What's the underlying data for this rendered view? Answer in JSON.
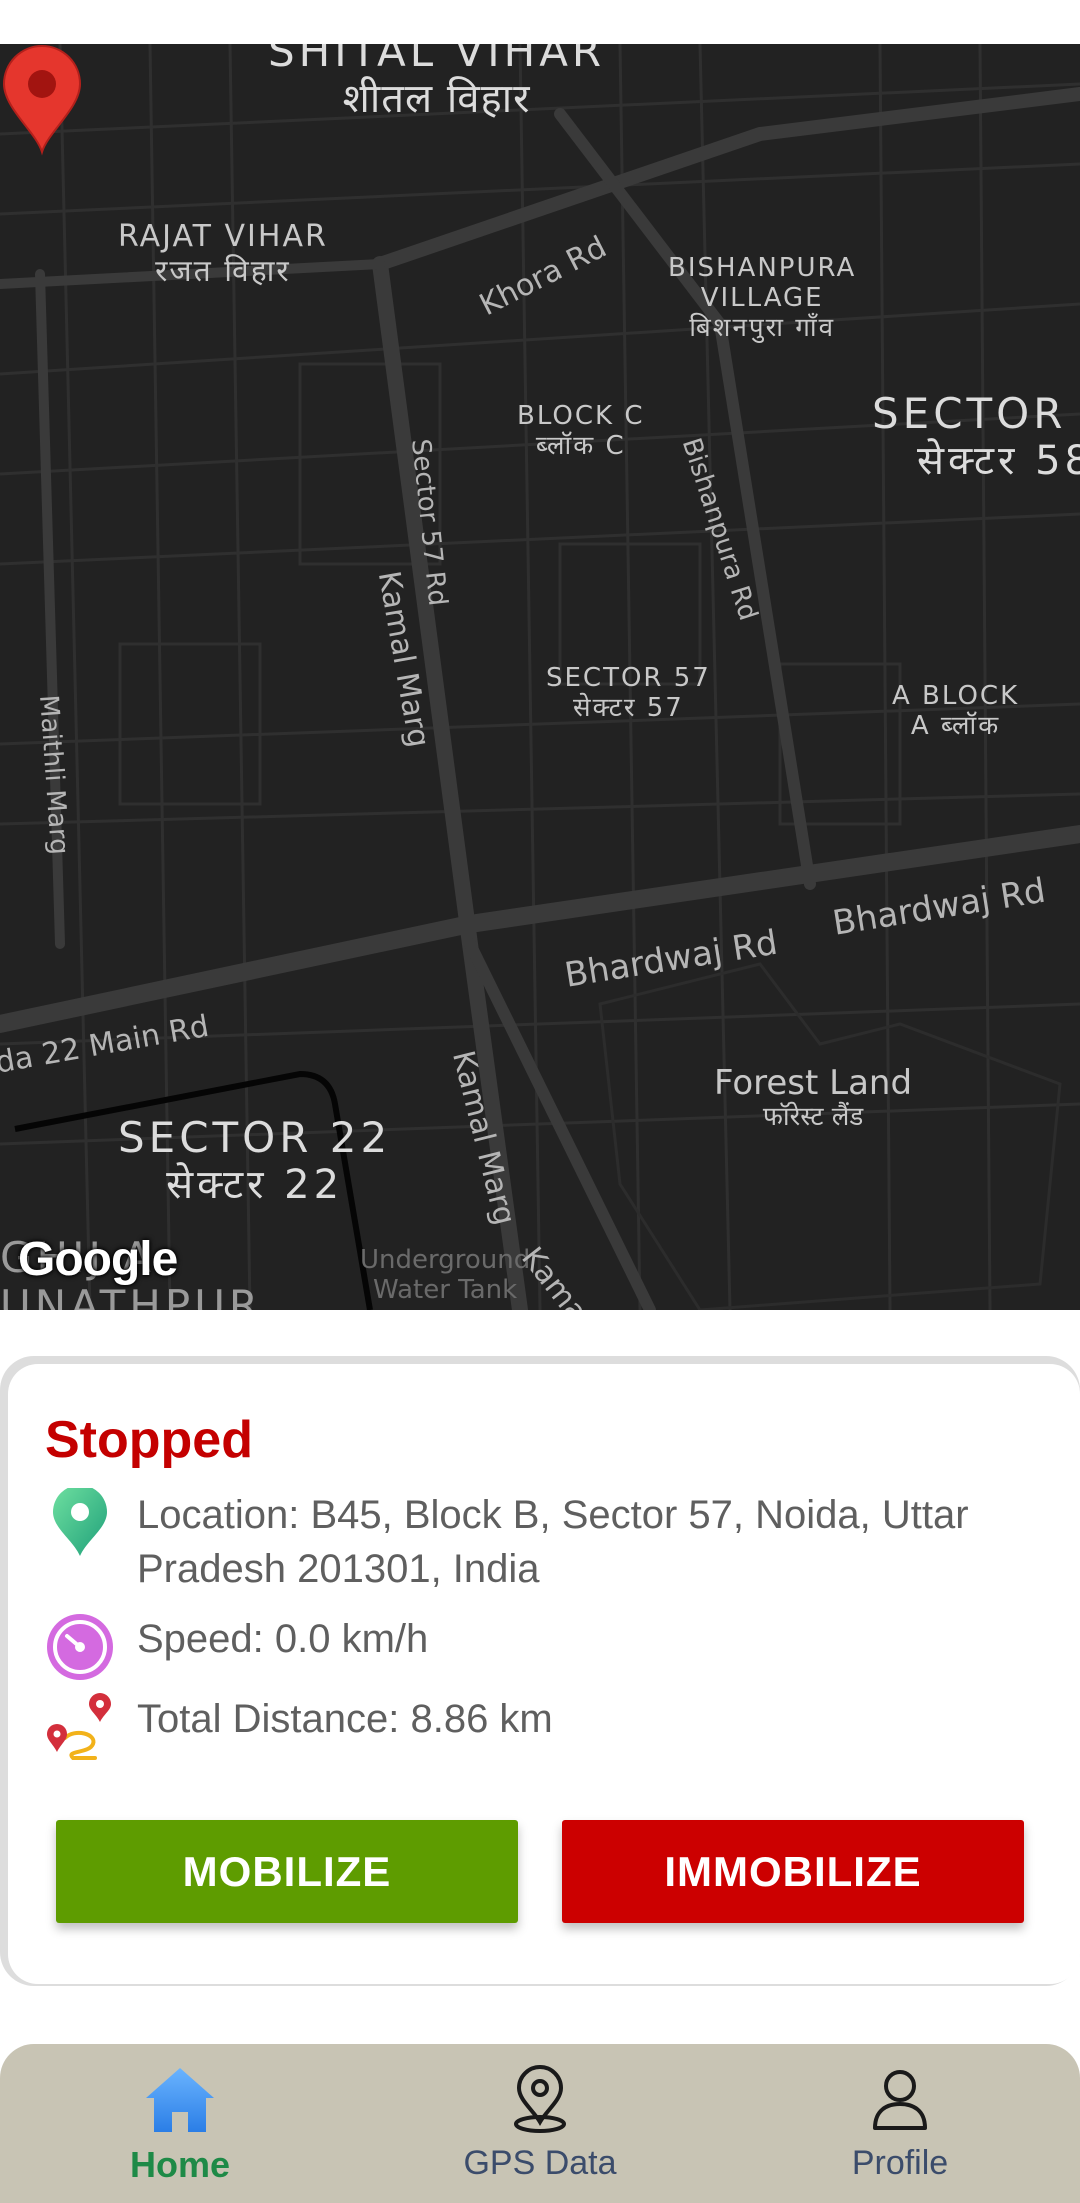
{
  "map": {
    "labels": {
      "shital_vihar_en": "SHITAL VIHAR",
      "shital_vihar_hi": "शीतल विहार",
      "rajat_vihar_en": "RAJAT VIHAR",
      "rajat_vihar_hi": "रजत विहार",
      "bishanpura_en1": "BISHANPURA",
      "bishanpura_en2": "VILLAGE",
      "bishanpura_hi": "बिशनपुरा गाँव",
      "block_c_en": "BLOCK C",
      "block_c_hi": "ब्लॉक C",
      "sector_58_en": "SECTOR",
      "sector_58_hi": "सेक्टर 58",
      "sector_57_en": "SECTOR 57",
      "sector_57_hi": "सेक्टर 57",
      "a_block_en": "A BLOCK",
      "a_block_hi": "A ब्लॉक",
      "forest_en": "Forest Land",
      "forest_hi": "फॉरेस्ट लैंड",
      "sector_22_en": "SECTOR 22",
      "sector_22_hi": "सेक्टर 22",
      "underground_1": "Underground",
      "underground_2": "Water Tank",
      "raghunathpur_1": "GHIJ A",
      "raghunathpur_2": "UNATHPUR"
    },
    "roads": {
      "khora": "Khora Rd",
      "bishanpura": "Bishanpura Rd",
      "sector57": "Sector 57 Rd",
      "kamal1": "Kamal Marg",
      "kamal2": "Kamal Marg",
      "kamal3": "Kamal Ma",
      "maithli": "Maithli Marg",
      "bhardwaj1": "Bhardwaj Rd",
      "bhardwaj2": "Bhardwaj Rd",
      "sector22main": "da 22 Main Rd"
    },
    "attribution": "Google"
  },
  "vehicle": {
    "status": "Stopped",
    "location": "Location: B45, Block B, Sector 57, Noida, Uttar Pradesh 201301, India",
    "speed": "Speed: 0.0 km/h",
    "distance": "Total Distance: 8.86 km"
  },
  "actions": {
    "mobilize": "MOBILIZE",
    "immobilize": "IMMOBILIZE"
  },
  "nav": {
    "items": [
      {
        "label": "Home",
        "icon": "home-icon",
        "active": true
      },
      {
        "label": "GPS Data",
        "icon": "location-pin-icon",
        "active": false
      },
      {
        "label": "Profile",
        "icon": "person-icon",
        "active": false
      }
    ]
  },
  "colors": {
    "stopped": "#c40000",
    "mobilize": "#5e9c00",
    "immobilize": "#cc0000",
    "nav_active": "#1e8a47",
    "nav_bg": "#c8c4b4"
  }
}
